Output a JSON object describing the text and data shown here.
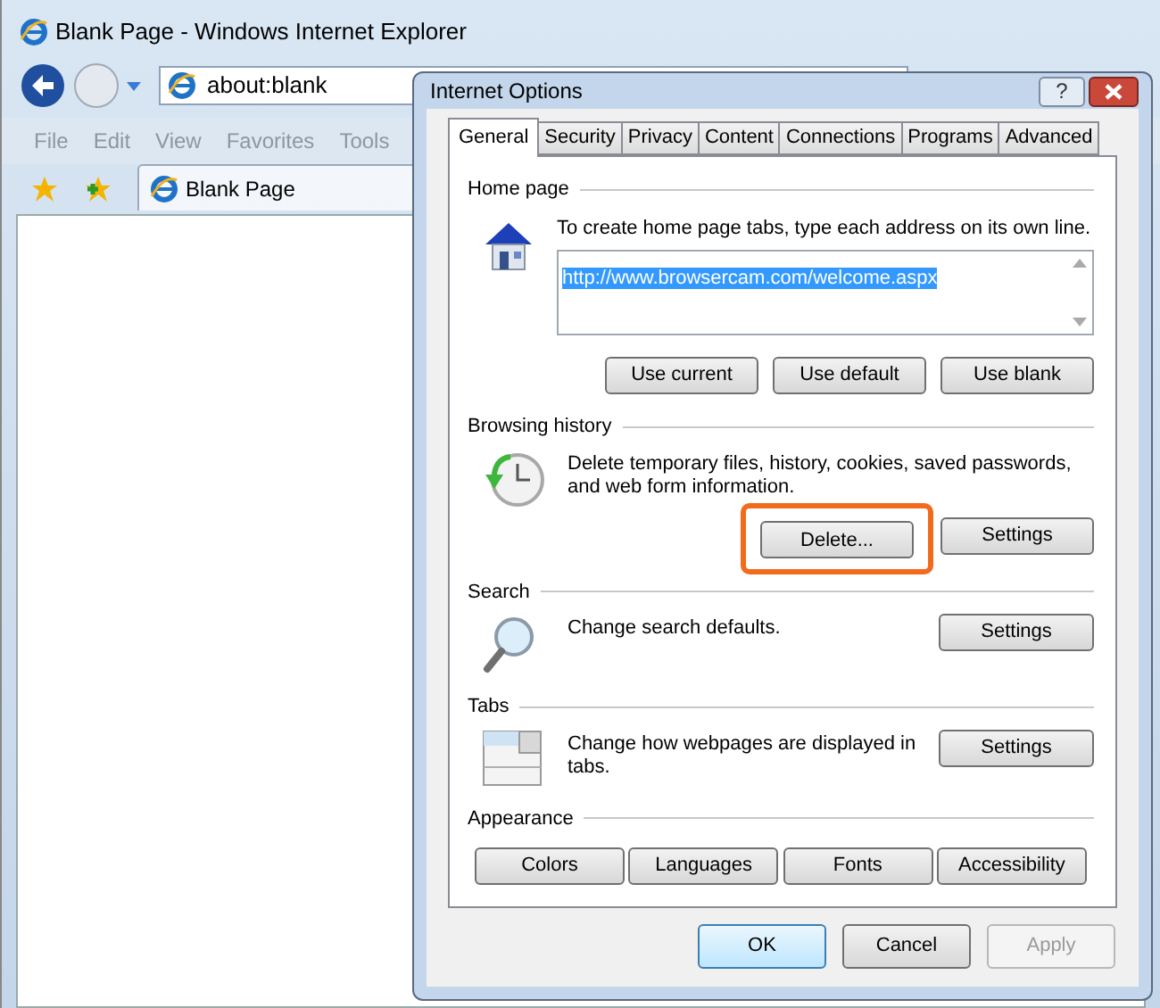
{
  "browser": {
    "title": "Blank Page - Windows Internet Explorer",
    "address": "about:blank",
    "menu": [
      "File",
      "Edit",
      "View",
      "Favorites",
      "Tools"
    ],
    "tab_title": "Blank Page"
  },
  "dialog": {
    "title": "Internet Options",
    "help": "?",
    "tabs": [
      {
        "label": "General",
        "selected": true
      },
      {
        "label": "Security",
        "selected": false
      },
      {
        "label": "Privacy",
        "selected": false
      },
      {
        "label": "Content",
        "selected": false
      },
      {
        "label": "Connections",
        "selected": false
      },
      {
        "label": "Programs",
        "selected": false
      },
      {
        "label": "Advanced",
        "selected": false
      }
    ],
    "sections": [
      {
        "kind": "home",
        "heading": "Home page",
        "description": "To create home page tabs, type each address on its own line.",
        "url": "http://www.browsercam.com/welcome.aspx",
        "buttons": [
          {
            "label": "Use current",
            "highlighted": false
          },
          {
            "label": "Use default",
            "highlighted": false
          },
          {
            "label": "Use blank",
            "highlighted": false
          }
        ]
      },
      {
        "kind": "history",
        "heading": "Browsing history",
        "description": "Delete temporary files, history, cookies, saved passwords, and web form information.",
        "buttons": [
          {
            "label": "Delete...",
            "highlighted": true
          },
          {
            "label": "Settings",
            "highlighted": false
          }
        ]
      },
      {
        "kind": "search",
        "heading": "Search",
        "description": "Change search defaults.",
        "buttons": [
          {
            "label": "Settings",
            "highlighted": false
          }
        ]
      },
      {
        "kind": "tabs",
        "heading": "Tabs",
        "description": "Change how webpages are displayed in tabs.",
        "buttons": [
          {
            "label": "Settings",
            "highlighted": false
          }
        ]
      },
      {
        "kind": "appearance",
        "heading": "Appearance",
        "buttons": [
          {
            "label": "Colors",
            "highlighted": false
          },
          {
            "label": "Languages",
            "highlighted": false
          },
          {
            "label": "Fonts",
            "highlighted": false
          },
          {
            "label": "Accessibility",
            "highlighted": false
          }
        ]
      }
    ],
    "footer": [
      {
        "label": "OK",
        "default": true,
        "disabled": false
      },
      {
        "label": "Cancel",
        "default": false,
        "disabled": false
      },
      {
        "label": "Apply",
        "default": false,
        "disabled": true
      }
    ]
  }
}
